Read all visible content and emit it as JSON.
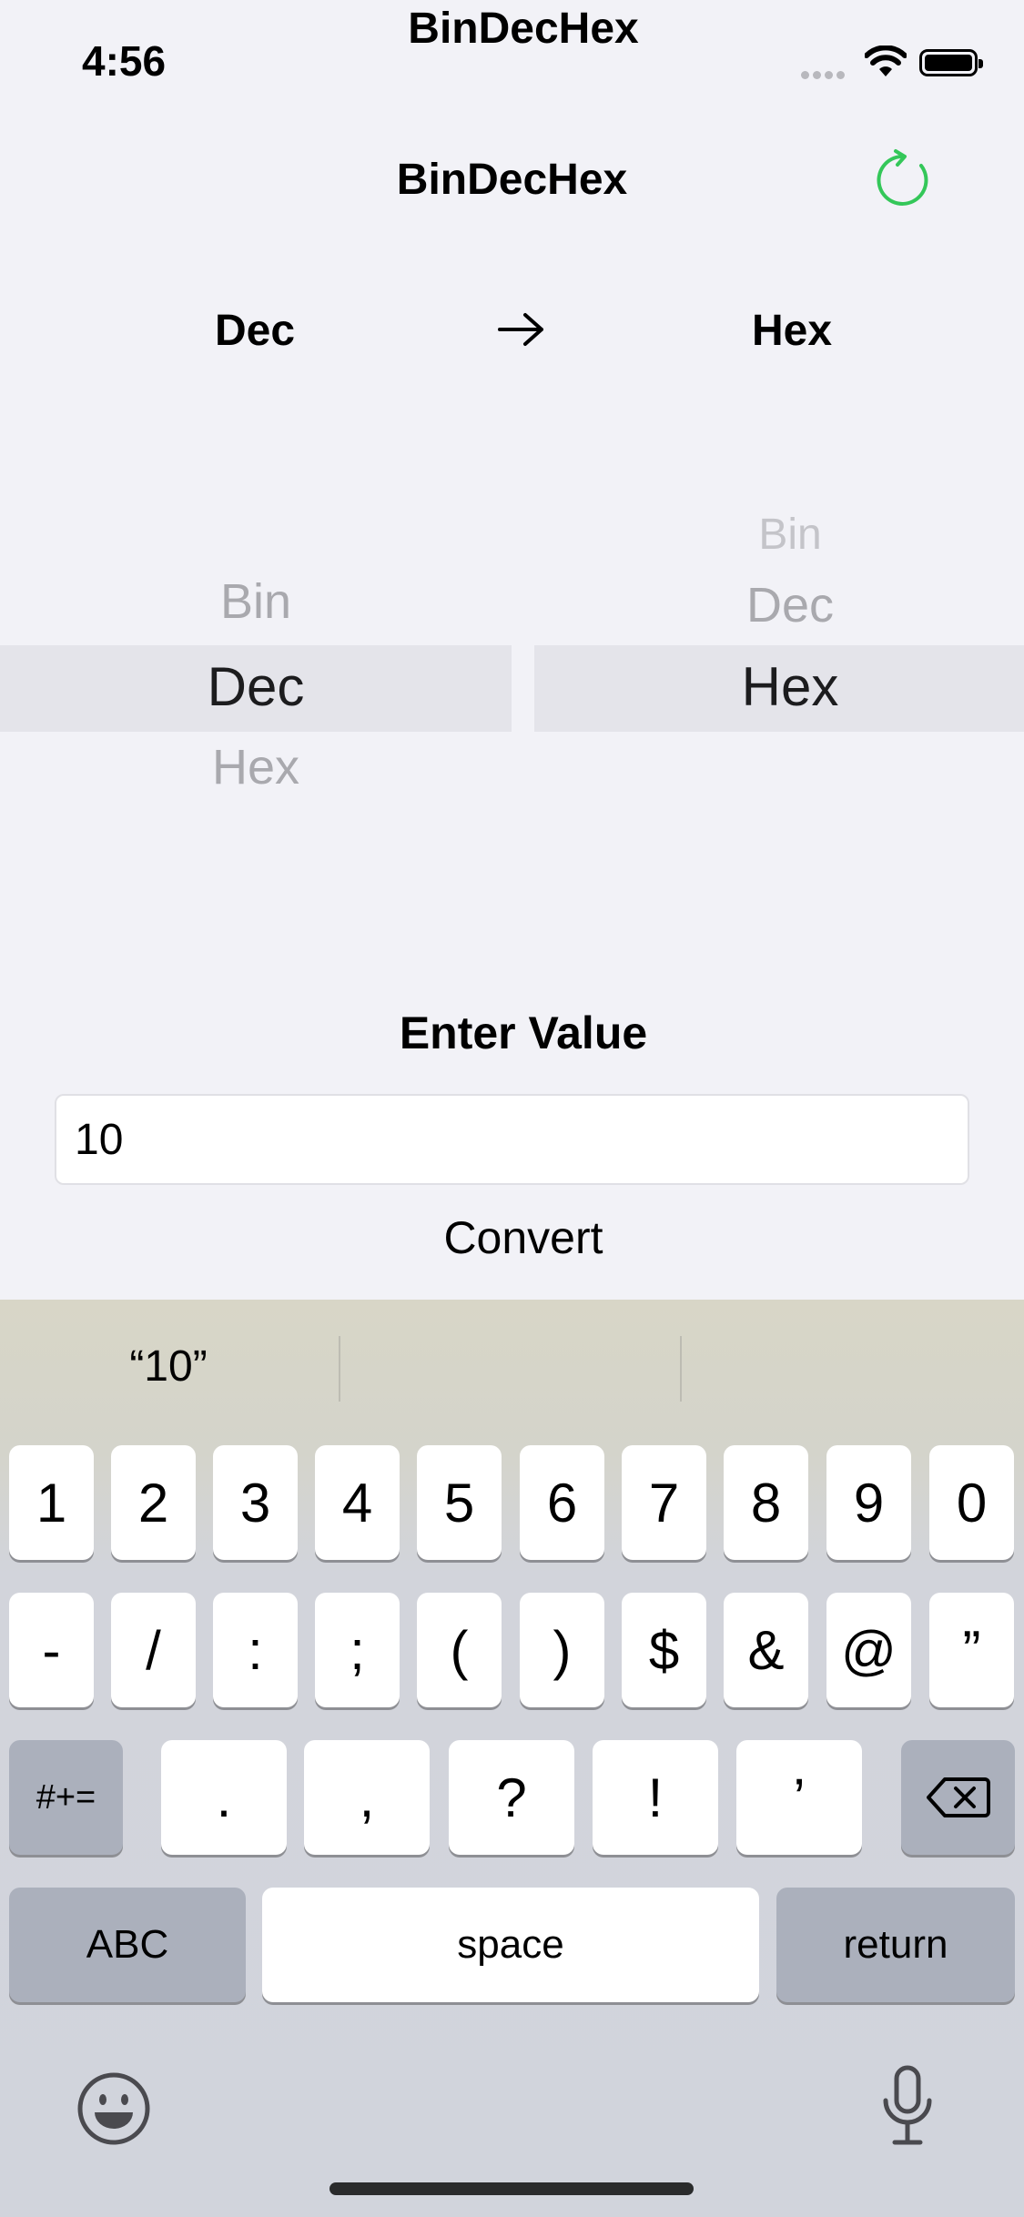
{
  "status": {
    "time": "4:56",
    "app_title": "BinDecHex"
  },
  "nav": {
    "title": "BinDecHex",
    "refresh_icon": "refresh-icon",
    "accent": "#34c759"
  },
  "direction": {
    "from": "Dec",
    "to": "Hex",
    "arrow_icon": "right-arrow-icon"
  },
  "picker_left": {
    "options": [
      "Bin",
      "Dec",
      "Hex"
    ],
    "selected": "Dec"
  },
  "picker_right": {
    "options": [
      "Bin",
      "Dec",
      "Hex"
    ],
    "selected": "Hex"
  },
  "input": {
    "label": "Enter Value",
    "value": "10"
  },
  "convert_label": "Convert",
  "keyboard": {
    "suggestion": "“10”",
    "row1": [
      "1",
      "2",
      "3",
      "4",
      "5",
      "6",
      "7",
      "8",
      "9",
      "0"
    ],
    "row2": [
      "-",
      "/",
      ":",
      ";",
      "(",
      ")",
      "$",
      "&",
      "@",
      "”"
    ],
    "row3": {
      "shift": "#+=",
      "keys": [
        ".",
        ",",
        "?",
        "!",
        "’"
      ],
      "delete_icon": "backspace-icon"
    },
    "row4": {
      "abc": "ABC",
      "space": "space",
      "return": "return"
    },
    "emoji_icon": "emoji-icon",
    "mic_icon": "microphone-icon"
  }
}
